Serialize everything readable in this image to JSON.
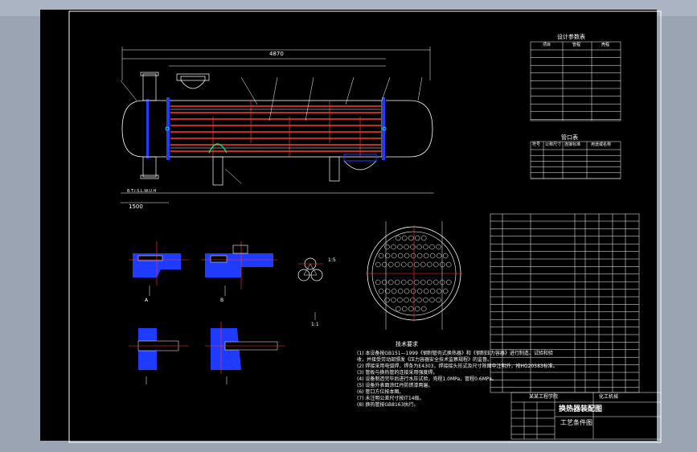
{
  "window": {
    "background": "#9aa4b3",
    "canvas": "#000000"
  },
  "colors": {
    "frame": "#ffffff",
    "tube": "#ff3b30",
    "cyan": "#00e5ff",
    "blue": "#1f3bff",
    "green": "#00ff66",
    "yellow": "#ffff00"
  },
  "drawing": {
    "overall_length_label": "4870",
    "left_dim_label": "1500",
    "side_label": "B.T.I.S.L.W.U.H"
  },
  "tables": {
    "design_params_title": "设计参数表",
    "nozzle_table_title": "管口表",
    "design_headers": [
      "项目",
      "管程",
      "壳程"
    ],
    "nozzle_headers": [
      "符号",
      "公称尺寸",
      "连接标准",
      "用途或名称"
    ]
  },
  "notes": {
    "title": "技术要求",
    "lines": [
      "(1) 本设备按GB151—1999《钢制管壳式换热器》和《钢制压力容器》进行制造、试验和验",
      "收，并接受劳动部颁发《压力容器安全技术监察规程》的监督。",
      "(2) 焊接采用电弧焊，焊条为E4303，焊接接头形式及尺寸除图中注明外，按HG20583标准。",
      "(3) 管板与换热管的连接采用强度焊。",
      "(4) 设备制造完毕后进行水压试验，壳程1.0MPa，管程0.6MPa。",
      "(5) 设备外表面涂红丹防锈漆两遍。",
      "(6) 管口方位按本图。",
      "(7) 未注明公差尺寸按IT14级。",
      "(8) 换热管按GB8163执行。"
    ]
  },
  "title_block": {
    "school": "某某工程学院",
    "drawing_title": "换热器装配图",
    "subtitle": "工艺条件图",
    "company": "化工机械"
  },
  "view_labels": {
    "detail_a": "A",
    "detail_b": "B",
    "scale_1": "1:5",
    "ratio": "1:1"
  }
}
